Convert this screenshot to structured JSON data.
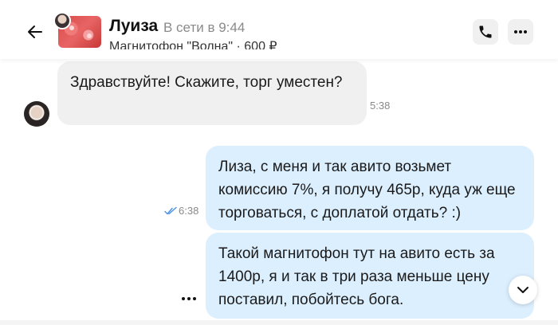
{
  "header": {
    "contact_name": "Луиза",
    "status": "В сети в 9:44",
    "item_title": "Магнитофон \"Волна\" · 600 ₽"
  },
  "messages": [
    {
      "direction": "incoming",
      "text": "Здравствуйте! Скажите, торг уместен?",
      "time": "5:38"
    },
    {
      "direction": "outgoing",
      "text": "Лиза, с меня и так авито возьмет комиссию 7%, я получу 465р, куда уж еще торговаться, с доплатой отдать? :)",
      "time": "6:38",
      "read": true
    },
    {
      "direction": "outgoing",
      "text": "Такой магнитофон тут на авито есть за 1400р, я и так в три раза меньше цену поставил, побойтесь бога."
    }
  ],
  "icons": {
    "back": "arrow-left-icon",
    "call": "phone-icon",
    "menu": "more-horizontal-icon",
    "read_status": "double-check-icon",
    "scroll": "chevron-down-icon"
  },
  "colors": {
    "incoming_bubble": "#f0f0f0",
    "outgoing_bubble": "#dcefff",
    "read_check": "#4a90e2"
  }
}
